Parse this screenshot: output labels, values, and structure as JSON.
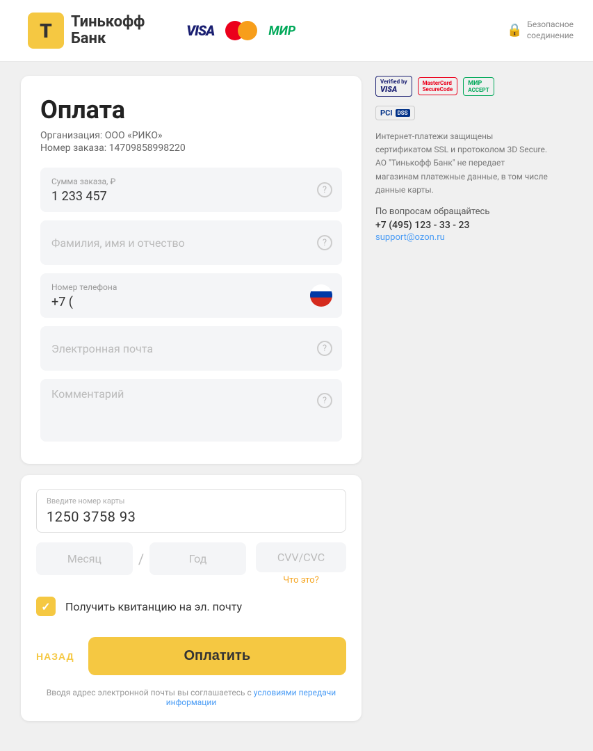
{
  "header": {
    "brand_name": "Тинькофф",
    "bank_label": "Банк",
    "visa_label": "VISA",
    "mir_label": "МИР"
  },
  "form": {
    "title": "Оплата",
    "org_label": "Организация: ООО «РИКО»",
    "order_label": "Номер заказа: 14709858998220",
    "secure_line1": "Безопасное",
    "secure_line2": "соединение",
    "amount_label": "Сумма заказа, ₽",
    "amount_value": "1 233 457",
    "fullname_placeholder": "Фамилия, имя и отчество",
    "phone_label": "Номер телефона",
    "phone_value": "+7 (",
    "email_placeholder": "Электронная почта",
    "comment_placeholder": "Комментарий"
  },
  "card": {
    "number_label": "Введите номер карты",
    "number_value": "1250  3758  93",
    "month_placeholder": "Месяц",
    "year_placeholder": "Год",
    "cvv_label": "CVV/CVC",
    "cvv_hint": "Что это?"
  },
  "checkbox": {
    "label": "Получить квитанцию на эл. почту",
    "checked": true
  },
  "actions": {
    "back_label": "НАЗАД",
    "pay_label": "Оплатить"
  },
  "footer": {
    "note_text": "Вводя адрес электронной почты вы соглашаетесь с ",
    "note_link_text": "условиями передачи информации"
  },
  "security": {
    "verified_visa": "Verified by VISA",
    "mc_secure": "MasterCard SecureCode",
    "mir_accept": "MIR ACCEPT",
    "pci_label": "PCI DSS",
    "desc": "Интернет-платежи защищены сертификатом SSL и протоколом 3D Secure. АО \"Тинькофф Банк\" не передает магазинам платежные данные, в том числе данные карты.",
    "support_label": "По вопросам обращайтесь",
    "phone": "+7 (495) 123 - 33 - 23",
    "email": "support@ozon.ru"
  }
}
